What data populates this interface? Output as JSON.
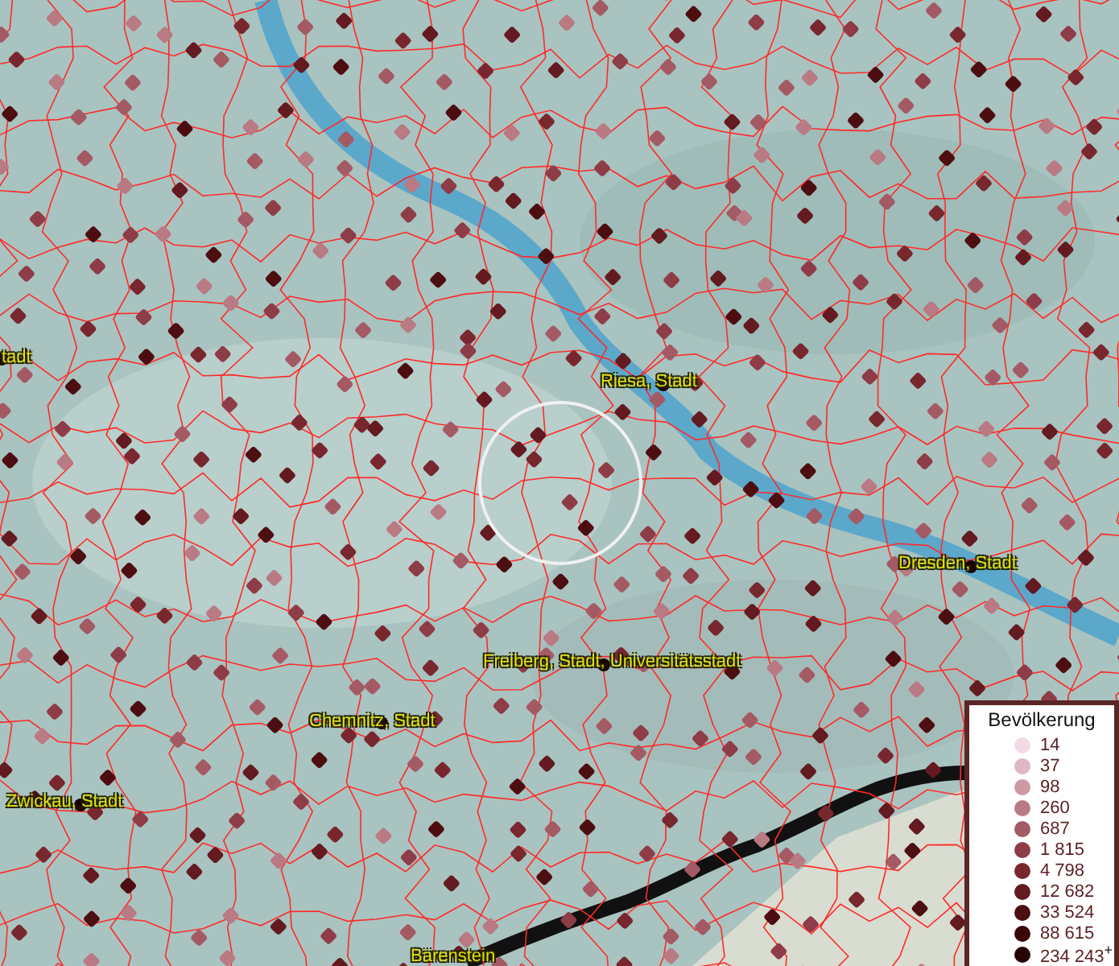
{
  "map": {
    "labels": [
      {
        "text": "tadt"
      },
      {
        "text": "Riesa, Stadt"
      },
      {
        "text": "Dresden, Stadt"
      },
      {
        "text": "Freiberg, Stadt, Universitätsstadt"
      },
      {
        "text": "Chemnitz, Stadt"
      },
      {
        "text": "Zwickau, Stadt"
      },
      {
        "text": "Bärenstein"
      }
    ]
  },
  "legend": {
    "title": "Bevölkerung",
    "items": [
      {
        "value": "14",
        "color": "#f3d9e6"
      },
      {
        "value": "37",
        "color": "#e0b7c2"
      },
      {
        "value": "98",
        "color": "#cc9aa3"
      },
      {
        "value": "260",
        "color": "#b97a84"
      },
      {
        "value": "687",
        "color": "#a45a64"
      },
      {
        "value": "1 815",
        "color": "#8e3c47"
      },
      {
        "value": "4 798",
        "color": "#79272f"
      },
      {
        "value": "12 682",
        "color": "#631a20"
      },
      {
        "value": "33 524",
        "color": "#4d0e12"
      },
      {
        "value": "88 615",
        "color": "#3a0709"
      },
      {
        "value": "234 243$^{+}$",
        "color": "#280304"
      }
    ]
  }
}
